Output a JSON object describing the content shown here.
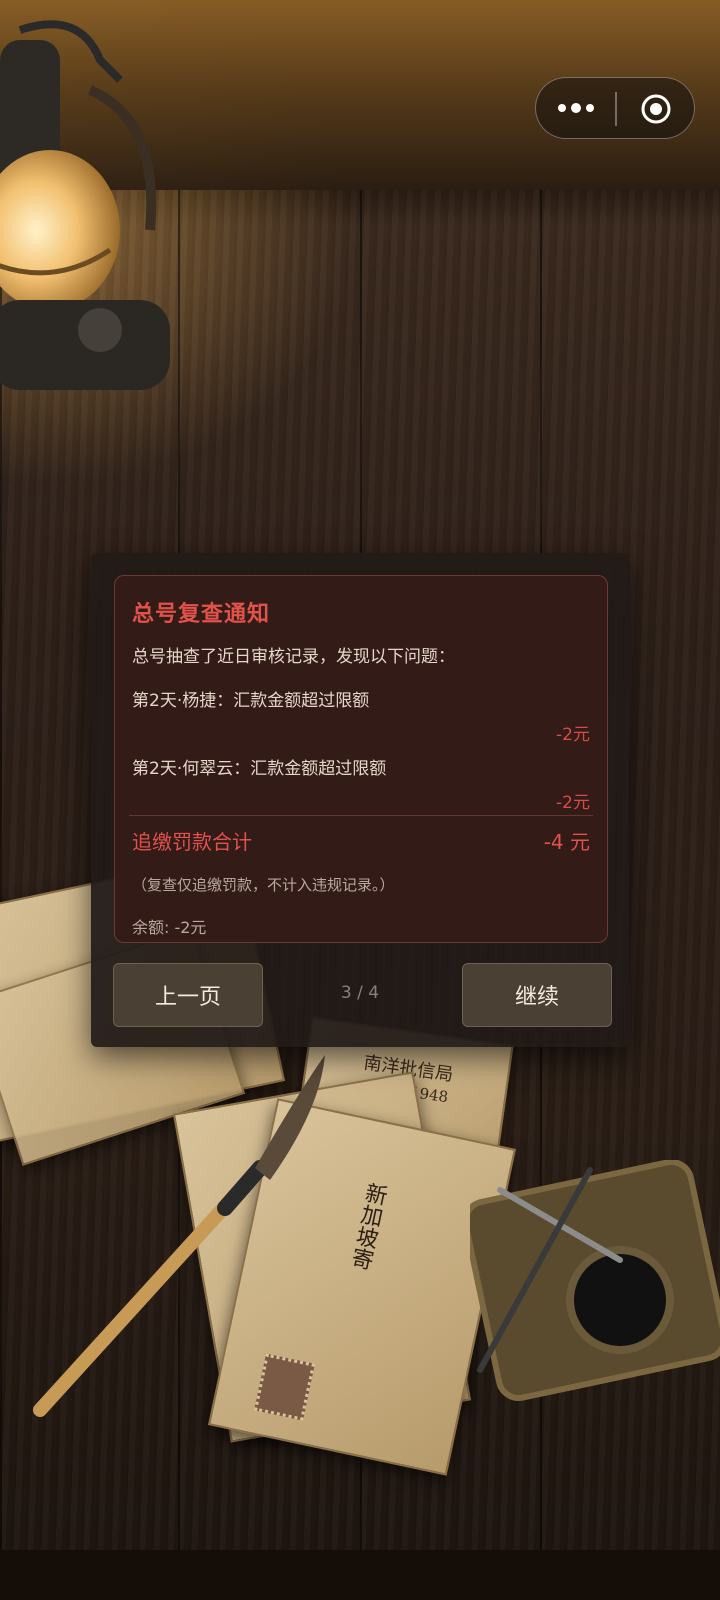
{
  "capsule_menu": {
    "more_icon": "more-dots-icon",
    "close_icon": "target-circle-icon"
  },
  "scene_text": {
    "envelope_stamp": "南洋批信局",
    "envelope_year": "1948",
    "envelope_address": "新加坡寄"
  },
  "notice": {
    "title": "总号复查通知",
    "intro": "总号抽查了近日审核记录，发现以下问题：",
    "issues": [
      {
        "text": "第2天·杨捷：汇款金额超过限额",
        "penalty": "-2元"
      },
      {
        "text": "第2天·何翠云：汇款金额超过限额",
        "penalty": "-2元"
      }
    ],
    "total_label": "追缴罚款合计",
    "total_value": "-4 元",
    "note": "（复查仅追缴罚款，不计入违规记录。）",
    "balance": "余额: -2元"
  },
  "nav": {
    "prev_label": "上一页",
    "next_label": "继续",
    "page_indicator": "3 / 4"
  },
  "colors": {
    "accent_red": "#e0524a",
    "dialog_bg": "#221b17",
    "notice_bg": "#331b18"
  }
}
